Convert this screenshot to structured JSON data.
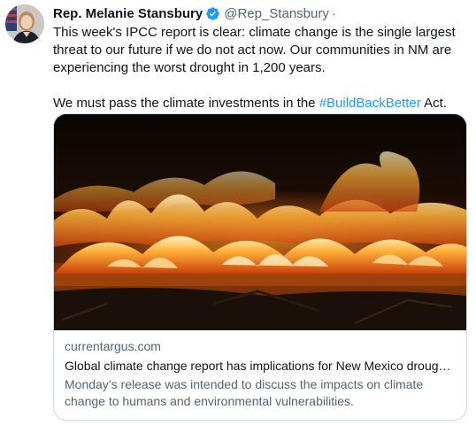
{
  "author": {
    "display_name": "Rep. Melanie Stansbury",
    "handle": "@Rep_Stansbury",
    "separator": "·",
    "verified": true
  },
  "tweet": {
    "paragraph1": "This week's IPCC report is clear: climate change is the single largest threat to our future if we do not act now. Our communities in NM are experiencing the worst drought in 1,200 years.",
    "paragraph2_prefix": "We must pass the climate investments in the ",
    "hashtag": "#BuildBackBetter",
    "paragraph2_suffix": " Act."
  },
  "card": {
    "domain": "currentargus.com",
    "title": "Global climate change report has implications for New Mexico drought...",
    "description": "Monday’s release was intended to discuss the impacts on climate change to humans and environmental vulnerabilities."
  },
  "colors": {
    "link": "#1d9bf0",
    "verified_badge": "#1d9bf0",
    "secondary_text": "#536471",
    "border": "#cfd9de"
  },
  "icons": {
    "verified": "verified-badge-icon"
  }
}
